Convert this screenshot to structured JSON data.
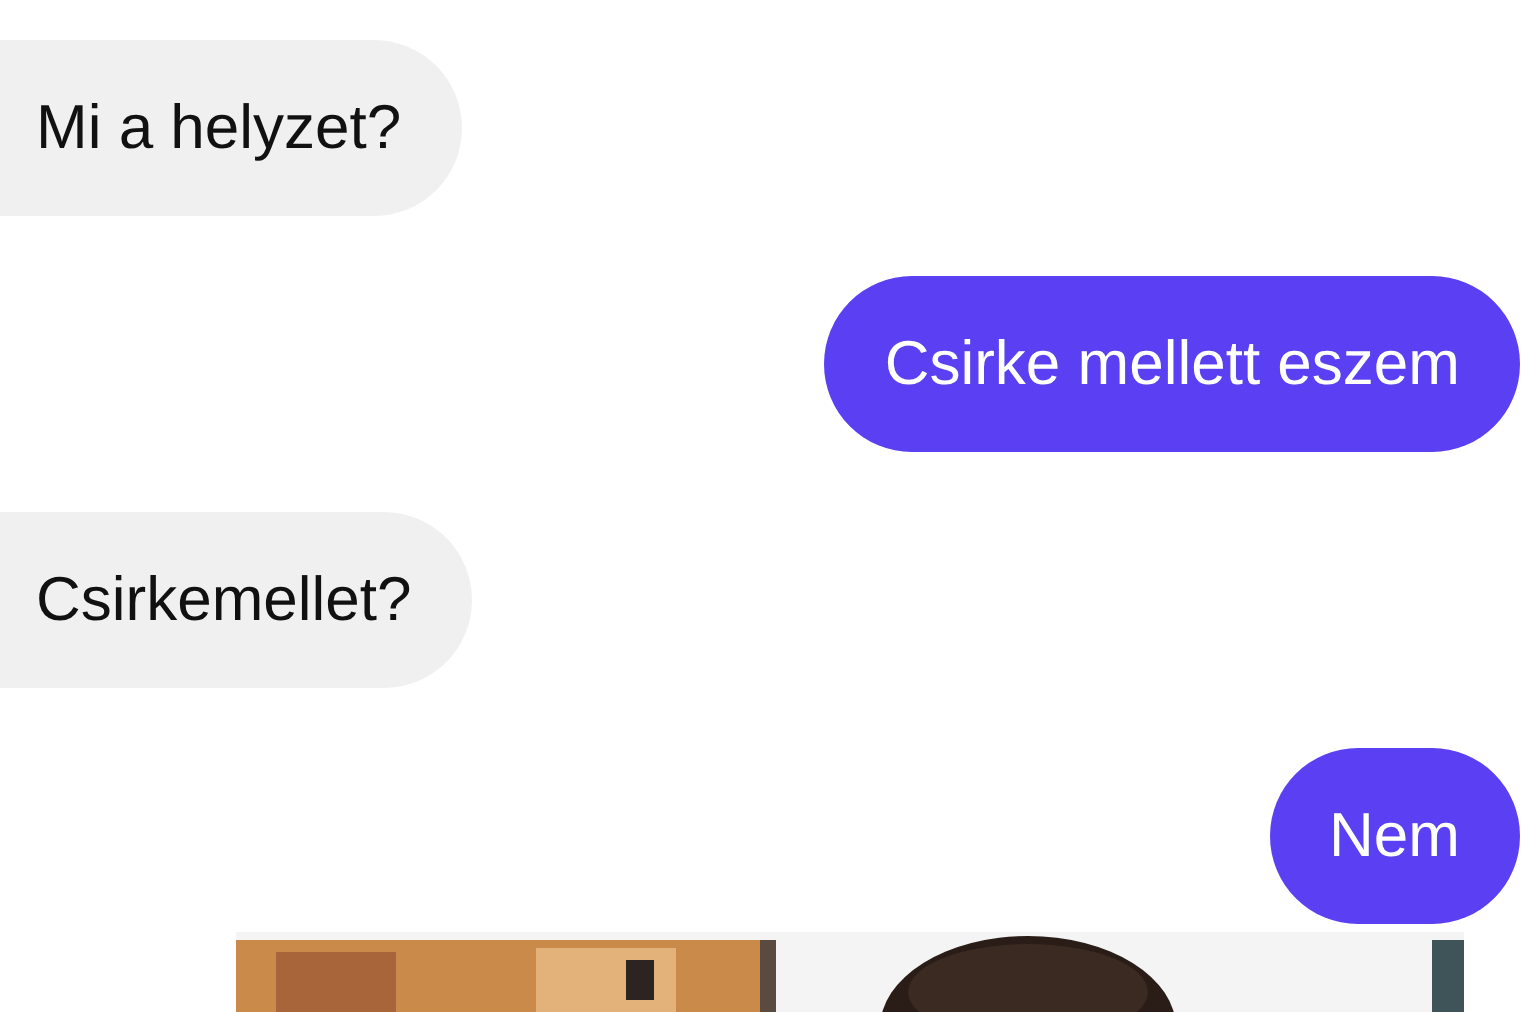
{
  "messages": [
    {
      "kind": "incoming",
      "text": "Mi a helyzet?"
    },
    {
      "kind": "outgoing",
      "text": "Csirke mellett eszem"
    },
    {
      "kind": "incoming",
      "text": "Csirkemellet?"
    },
    {
      "kind": "outgoing",
      "text": "Nem"
    }
  ]
}
